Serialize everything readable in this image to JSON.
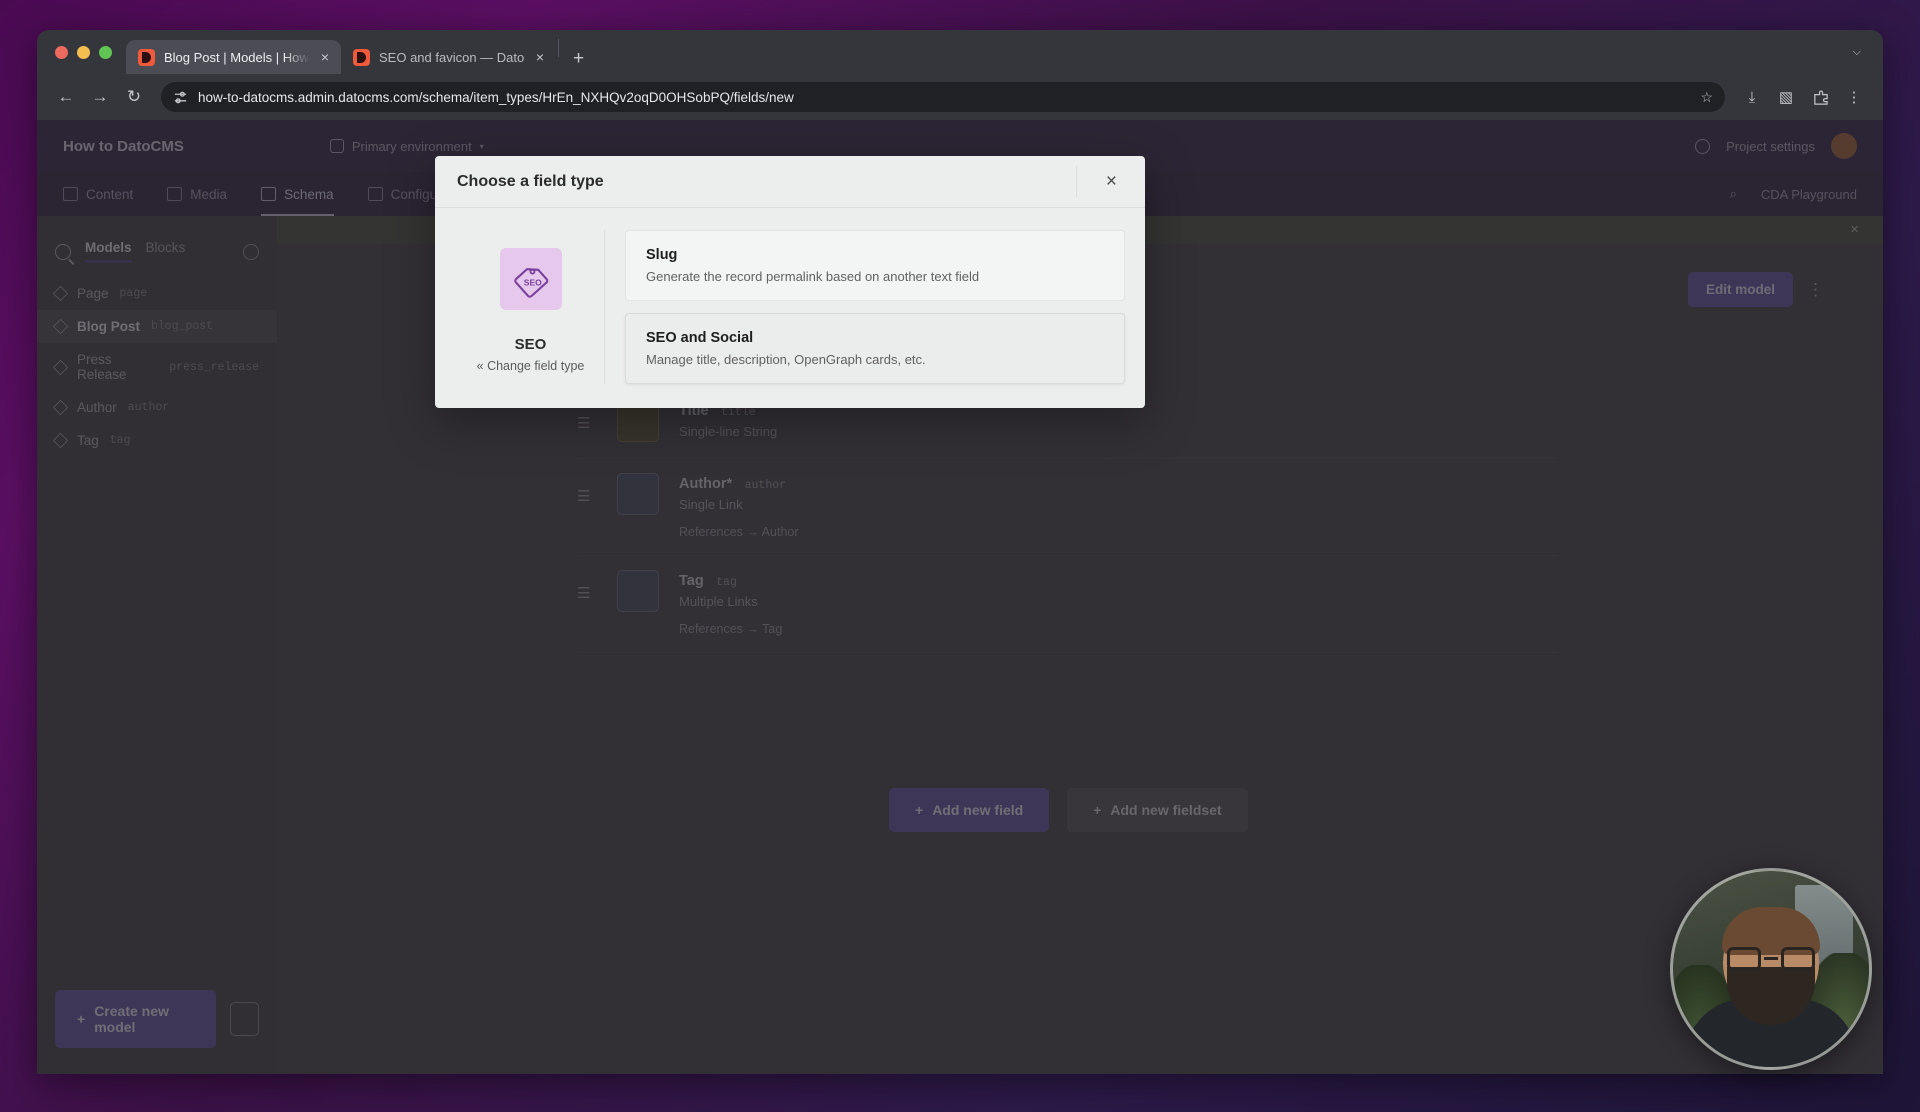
{
  "browser": {
    "tabs": [
      {
        "title": "Blog Post | Models | How to D",
        "favicon": "datocms-favicon",
        "close": "×",
        "active": true
      },
      {
        "title": "SEO and favicon — DatoCMS",
        "favicon": "datocms-favicon",
        "close": "×",
        "active": false
      }
    ],
    "new_tab": "+",
    "tabstrip_chevron": "⌵",
    "nav": {
      "back": "←",
      "forward": "→",
      "reload": "↻"
    },
    "omnibox": {
      "url": "how-to-datocms.admin.datocms.com/schema/item_types/HrEn_NXHQv2oqD0OHSobPQ/fields/new",
      "site_settings_icon": "tune-icon",
      "bookmark_star": "☆"
    },
    "toolbar_icons": {
      "download": "⤓",
      "sidepanel": "▧",
      "extensions": "⚙",
      "menu": "⋮"
    }
  },
  "app": {
    "header": {
      "project": "How to DatoCMS",
      "environment": "Primary environment",
      "environment_caret": "▾",
      "project_settings": "Project settings"
    },
    "nav": [
      {
        "label": "Content",
        "active": false
      },
      {
        "label": "Media",
        "active": false
      },
      {
        "label": "Schema",
        "active": true
      },
      {
        "label": "Configuration",
        "active": false
      }
    ],
    "nav_right": {
      "search": "⌕",
      "cda_playground": "CDA Playground"
    },
    "sidebar": {
      "tabs": [
        {
          "label": "Models",
          "active": true
        },
        {
          "label": "Blocks",
          "active": false
        }
      ],
      "models": [
        {
          "name": "Page",
          "api_key": "page",
          "active": false
        },
        {
          "name": "Blog Post",
          "api_key": "blog_post",
          "active": true
        },
        {
          "name": "Press Release",
          "api_key": "press_release",
          "active": false
        },
        {
          "name": "Author",
          "api_key": "author",
          "active": false
        },
        {
          "name": "Tag",
          "api_key": "tag",
          "active": false
        }
      ],
      "create_model_button": "Create new model",
      "create_model_plus": "+",
      "new_folder_icon": "folder-plus-icon"
    },
    "main": {
      "edit_model_button": "Edit model",
      "kebab": "⋮",
      "notice_close": "×",
      "fields": [
        {
          "name": "Title",
          "api_key": "title",
          "type": "Single-line String",
          "reference": "",
          "icon": "text-field-icon"
        },
        {
          "name": "Author*",
          "api_key": "author",
          "type": "Single Link",
          "reference": "References → Author",
          "icon": "link-field-icon"
        },
        {
          "name": "Tag",
          "api_key": "tag",
          "type": "Multiple Links",
          "reference": "References → Tag",
          "icon": "link-field-icon"
        }
      ],
      "add_field_button": "Add new field",
      "add_field_plus": "+",
      "add_fieldset_button": "Add new fieldset",
      "add_fieldset_plus": "+"
    }
  },
  "modal": {
    "title": "Choose a field type",
    "close": "×",
    "field_type": {
      "icon": "seo-tag-icon",
      "name": "SEO",
      "change_link": "« Change field type"
    },
    "options": [
      {
        "title": "Slug",
        "description": "Generate the record permalink based on another text field",
        "hovered": false
      },
      {
        "title": "SEO and Social",
        "description": "Manage title, description, OpenGraph cards, etc.",
        "hovered": true
      }
    ]
  },
  "webcam": {
    "label": "presenter-webcam"
  },
  "colors": {
    "accent_purple": "#6b5aa0",
    "seo_tile": "#e5c8ec",
    "seo_glyph": "#7a3f9d",
    "modal_bg": "#eceded",
    "browser_chrome": "#35363b"
  }
}
